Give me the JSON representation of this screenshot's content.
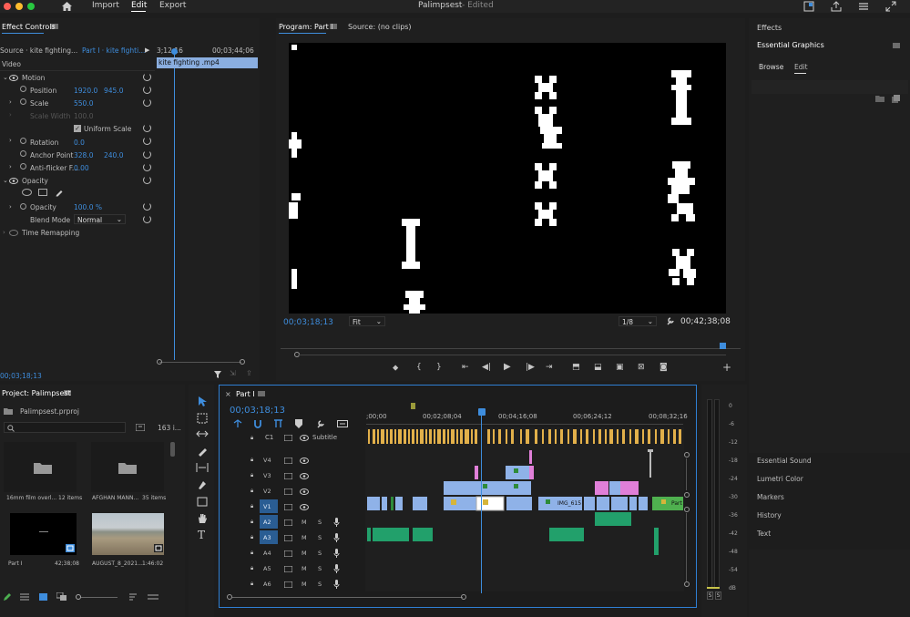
{
  "menu": {
    "import": "Import",
    "edit": "Edit",
    "export": "Export"
  },
  "title": {
    "name": "Palimpsest",
    "status": "- Edited"
  },
  "effect_controls": {
    "tab": "Effect Controls",
    "source": "Source · kite fighting...",
    "sequence": "Part I · kite fighti...",
    "tc_start": "3;12;16",
    "tc_end": "00;03;44;06",
    "clip_name": "kite fighting .mp4",
    "video_label": "Video",
    "motion": "Motion",
    "position_label": "Position",
    "position_x": "1920.0",
    "position_y": "945.0",
    "scale_label": "Scale",
    "scale_val": "550.0",
    "scale_width_label": "Scale Width",
    "scale_width_val": "100.0",
    "uniform_scale": "Uniform Scale",
    "rotation_label": "Rotation",
    "rotation_val": "0.0",
    "anchor_label": "Anchor Point",
    "anchor_x": "328.0",
    "anchor_y": "240.0",
    "antiflicker_label": "Anti-flicker F...",
    "antiflicker_val": "0.00",
    "opacity_group": "Opacity",
    "opacity_label": "Opacity",
    "opacity_val": "100.0 %",
    "blend_label": "Blend Mode",
    "blend_val": "Normal",
    "time_remap": "Time Remapping",
    "footer_tc": "00;03;18;13"
  },
  "program": {
    "tab": "Program: Part I",
    "source_tab": "Source: (no clips)",
    "timecode": "00;03;18;13",
    "fit": "Fit",
    "resolution": "1/8",
    "duration": "00;42;38;08"
  },
  "right": {
    "effects": "Effects",
    "essential_graphics": "Essential Graphics",
    "browse": "Browse",
    "edit": "Edit",
    "essential_sound": "Essential Sound",
    "lumetri": "Lumetri Color",
    "markers": "Markers",
    "history": "History",
    "text": "Text"
  },
  "project": {
    "tab": "Project: Palimpsest",
    "file": "Palimpsest.prproj",
    "count": "163 i...",
    "bins": [
      {
        "name": "16mm film overl...",
        "meta": "12 items"
      },
      {
        "name": "AFGHAN MANN...",
        "meta": "35 items"
      },
      {
        "name": "Part I",
        "meta": "42;38;08"
      },
      {
        "name": "AUGUST_8_2021...",
        "meta": "1:46:02"
      }
    ]
  },
  "timeline": {
    "tab": "Part I",
    "timecode": "00;03;18;13",
    "ruler": [
      ";00;00",
      "00;02;08;04",
      "00;04;16;08",
      "00;06;24;12",
      "00;08;32;16"
    ],
    "subtitle": "Subtitle",
    "video_tracks": [
      "V4",
      "V3",
      "V2",
      "V1"
    ],
    "audio_tracks": [
      "A2",
      "A3",
      "A4",
      "A5",
      "A6"
    ],
    "c1": "C1",
    "clip_img": "IMG_615",
    "clip_part": "Part",
    "m": "M",
    "s": "S"
  },
  "meter": {
    "labels": [
      "0",
      "-6",
      "-12",
      "-18",
      "-24",
      "-30",
      "-36",
      "-42",
      "-48",
      "-54",
      "dB"
    ],
    "solo": "S"
  }
}
